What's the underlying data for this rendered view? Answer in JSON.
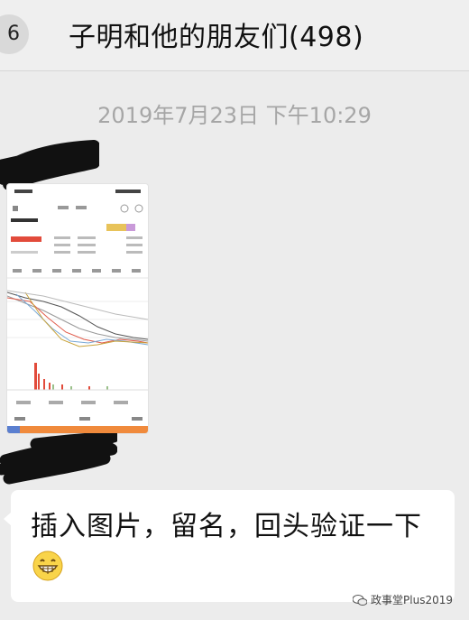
{
  "header": {
    "back_badge": "6",
    "title": "子明和他的朋友们(498)"
  },
  "timestamp": "2019年7月23日 下午10:29",
  "messages": [
    {
      "type": "image",
      "description": "stock-app-screenshot"
    },
    {
      "type": "text",
      "text": "插入图片，留名，回头验证一下",
      "emoji": "grinning-face"
    }
  ],
  "watermark": "政事堂Plus2019",
  "colors": {
    "background": "#ececec",
    "bubble": "#ffffff",
    "timestamp": "#a6a6a6",
    "redaction": "#111111"
  }
}
